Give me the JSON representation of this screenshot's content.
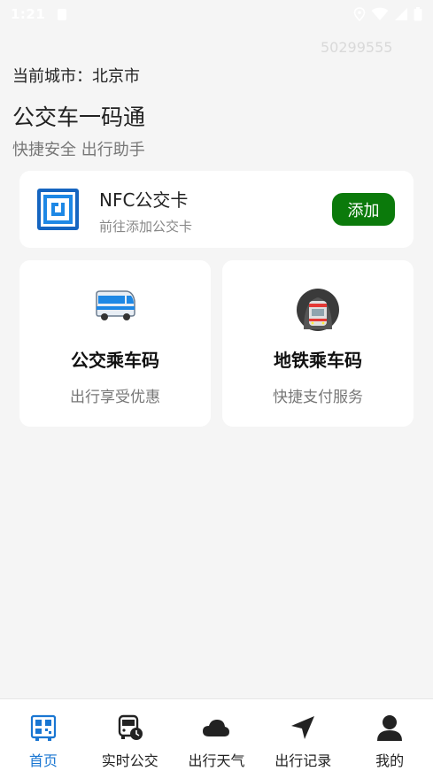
{
  "status_bar": {
    "time": "1:21"
  },
  "watermark": "50299555",
  "header": {
    "city_label": "当前城市：北京市",
    "title": "公交车一码通",
    "subtitle": "快捷安全  出行助手"
  },
  "nfc_card": {
    "name": "NFC公交卡",
    "hint": "前往添加公交卡",
    "add_label": "添加",
    "add_color": "#0b7a0b"
  },
  "tiles": [
    {
      "title": "公交乘车码",
      "subtitle": "出行享受优惠",
      "icon": "bus-icon"
    },
    {
      "title": "地铁乘车码",
      "subtitle": "快捷支付服务",
      "icon": "metro-icon"
    }
  ],
  "bottom_nav": {
    "active_color": "#1976d2",
    "items": [
      {
        "label": "首页",
        "icon": "home-qr-icon",
        "active": true
      },
      {
        "label": "实时公交",
        "icon": "realtime-bus-icon",
        "active": false
      },
      {
        "label": "出行天气",
        "icon": "cloud-icon",
        "active": false
      },
      {
        "label": "出行记录",
        "icon": "navigation-arrow-icon",
        "active": false
      },
      {
        "label": "我的",
        "icon": "user-icon",
        "active": false
      }
    ]
  }
}
